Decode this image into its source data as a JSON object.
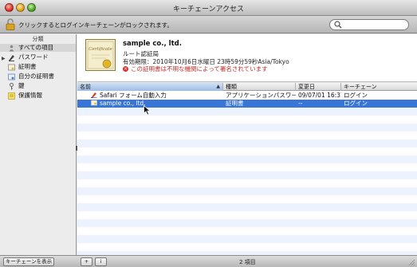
{
  "window": {
    "title": "キーチェーンアクセス"
  },
  "toolbar": {
    "lock_text": "クリックするとログインキーチェーンがロックされます。",
    "search_placeholder": ""
  },
  "sidebar": {
    "header": "分類",
    "items": [
      {
        "label": "すべての項目",
        "icon": "people-icon",
        "selected": true
      },
      {
        "label": "パスワード",
        "icon": "password-icon"
      },
      {
        "label": "証明書",
        "icon": "certificate-icon"
      },
      {
        "label": "自分の証明書",
        "icon": "my-certificate-icon"
      },
      {
        "label": "鍵",
        "icon": "key-icon"
      },
      {
        "label": "保護情報",
        "icon": "secure-note-icon"
      }
    ]
  },
  "detail": {
    "name": "sample co., ltd.",
    "kind": "ルート認証局",
    "expires": "有効期限：2010年10月6日水曜日 23時59分59秒Asia/Tokyo",
    "warning": "この証明書は不明な機関によって署名されています",
    "cert_image_text": "Certificate"
  },
  "table": {
    "columns": [
      "名前",
      "種類",
      "変更日",
      "キーチェーン"
    ],
    "rows": [
      {
        "name": "Safari フォーム自動入力",
        "kind": "アプリケーションパスワード",
        "date": "09/07/01 16:31",
        "keychain": "ログイン",
        "icon": "safari-form-icon",
        "selected": false
      },
      {
        "name": "sample co., ltd.",
        "kind": "証明書",
        "date": "--",
        "keychain": "ログイン",
        "icon": "certificate-icon",
        "selected": true
      }
    ]
  },
  "bottombar": {
    "show_keychains": "キーチェーンを表示",
    "add": "+",
    "info": "i",
    "count": "2 項目"
  },
  "colors": {
    "selection": "#3875d7",
    "warning": "#c22a2a",
    "alt_row": "#edf3fe"
  }
}
